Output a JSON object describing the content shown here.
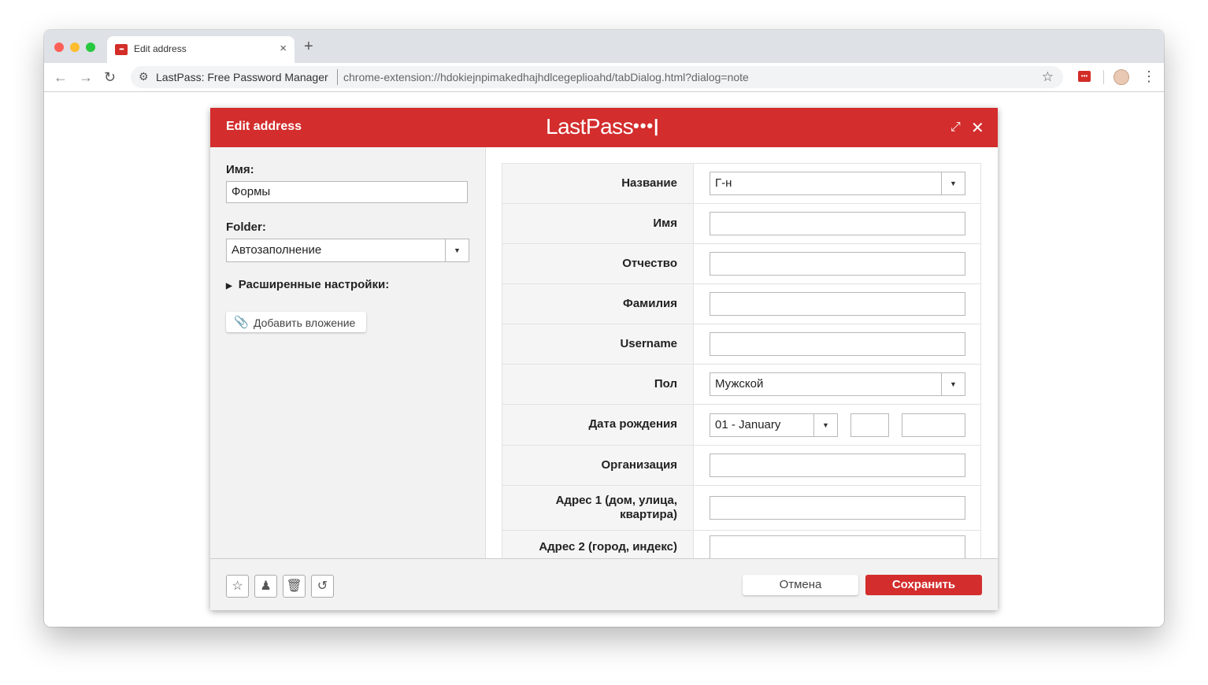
{
  "browser": {
    "tab_title": "Edit address",
    "tab_favicon": "•••",
    "tab_close": "×",
    "new_tab": "+",
    "omnibox_origin": "LastPass: Free Password Manager",
    "omnibox_url": "chrome-extension://hdokiejnpimakedhajhdlcegeplioahd/tabDialog.html?dialog=note",
    "ext_badge": "•••"
  },
  "dialog": {
    "title": "Edit address",
    "logo": "LastPass",
    "logo_dots": "•••|"
  },
  "left": {
    "name_label": "Имя:",
    "name_value": "Формы",
    "folder_label": "Folder:",
    "folder_value": "Автозаполнение",
    "advanced_label": "Расширенные настройки:",
    "attach_label": "Добавить вложение"
  },
  "form": {
    "title_label": "Название",
    "title_value": "Г-н",
    "first_name_label": "Имя",
    "middle_name_label": "Отчество",
    "last_name_label": "Фамилия",
    "username_label": "Username",
    "gender_label": "Пол",
    "gender_value": "Мужской",
    "birthdate_label": "Дата рождения",
    "birthdate_month": "01 - January",
    "company_label": "Организация",
    "address1_label_line1": "Адрес 1 (дом, улица,",
    "address1_label_line2": "квартира)",
    "address2_label": "Адрес 2 (город, индекс)"
  },
  "footer": {
    "cancel_label": "Отмена",
    "save_label": "Сохранить"
  },
  "colors": {
    "brand_red": "#d32d2d",
    "chrome_tabbar": "#dee1e6"
  }
}
